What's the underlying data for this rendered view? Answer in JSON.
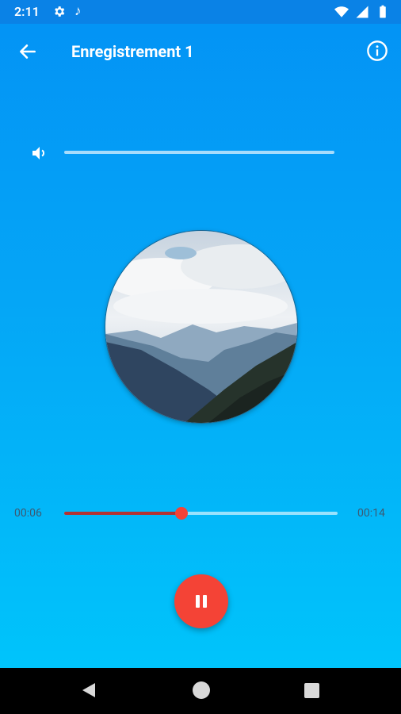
{
  "status_bar": {
    "time": "2:11",
    "icons": [
      "settings-icon",
      "music-note-icon",
      "wifi-icon",
      "signal-icon",
      "battery-icon"
    ],
    "music_glyph": "♪"
  },
  "app_bar": {
    "title": "Enregistrement 1",
    "back_icon": "arrow-back-icon",
    "info_icon": "info-icon"
  },
  "volume": {
    "icon": "volume-icon",
    "level": 1.0
  },
  "artwork": {
    "description_icon": "album-art"
  },
  "player": {
    "elapsed": "00:06",
    "total": "00:14",
    "progress": 0.43,
    "state_icon": "pause-icon"
  },
  "colors": {
    "accent": "#f44336",
    "progress_fill": "#b23232",
    "background_top": "#0392f5",
    "background_bottom": "#00c4fb"
  },
  "nav_bar": {
    "icons": [
      "nav-back-icon",
      "nav-home-icon",
      "nav-recents-icon"
    ]
  }
}
